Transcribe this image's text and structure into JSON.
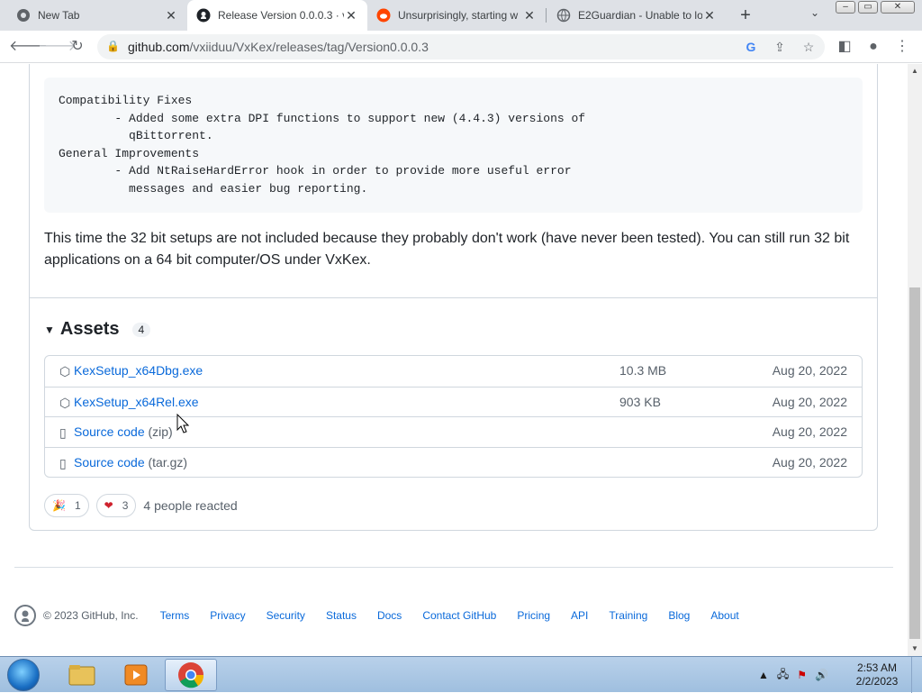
{
  "browser": {
    "tabs": [
      {
        "title": "New Tab",
        "icon": "chrome-icon",
        "active": false
      },
      {
        "title": "Release Version 0.0.0.3 · v",
        "icon": "github-icon",
        "active": true
      },
      {
        "title": "Unsurprisingly, starting w",
        "icon": "reddit-icon",
        "active": false
      },
      {
        "title": "E2Guardian - Unable to lo",
        "icon": "globe-icon",
        "active": false
      }
    ],
    "new_tab_label": "+",
    "url_host": "github.com",
    "url_path": "/vxiiduu/VxKex/releases/tag/Version0.0.0.3"
  },
  "release": {
    "code_block": "Compatibility Fixes\n        - Added some extra DPI functions to support new (4.4.3) versions of\n          qBittorrent.\nGeneral Improvements\n        - Add NtRaiseHardError hook in order to provide more useful error\n          messages and easier bug reporting.",
    "paragraph": "This time the 32 bit setups are not included because they probably don't work (have never been tested). You can still run 32 bit applications on a 64 bit computer/OS under VxKex.",
    "assets_title": "Assets",
    "assets_count": "4",
    "assets": [
      {
        "name": "KexSetup_x64Dbg.exe",
        "suffix": "",
        "size": "10.3 MB",
        "date": "Aug 20, 2022",
        "icon": "package-icon"
      },
      {
        "name": "KexSetup_x64Rel.exe",
        "suffix": "",
        "size": "903 KB",
        "date": "Aug 20, 2022",
        "icon": "package-icon"
      },
      {
        "name": "Source code",
        "suffix": " (zip)",
        "size": "",
        "date": "Aug 20, 2022",
        "icon": "file-zip-icon"
      },
      {
        "name": "Source code",
        "suffix": " (tar.gz)",
        "size": "",
        "date": "Aug 20, 2022",
        "icon": "file-zip-icon"
      }
    ],
    "reactions": [
      {
        "emoji": "🎉",
        "count": "1",
        "icon": "hooray-icon"
      },
      {
        "emoji": "❤",
        "count": "3",
        "icon": "heart-icon"
      }
    ],
    "reactions_text": "4 people reacted"
  },
  "footer": {
    "copyright": "© 2023 GitHub, Inc.",
    "links": [
      "Terms",
      "Privacy",
      "Security",
      "Status",
      "Docs",
      "Contact GitHub",
      "Pricing",
      "API",
      "Training",
      "Blog",
      "About"
    ]
  },
  "taskbar": {
    "time": "2:53 AM",
    "date": "2/2/2023"
  },
  "colors": {
    "link": "#0969da",
    "border": "#d0d7de",
    "muted": "#57606a",
    "heart": "#cf222e"
  }
}
